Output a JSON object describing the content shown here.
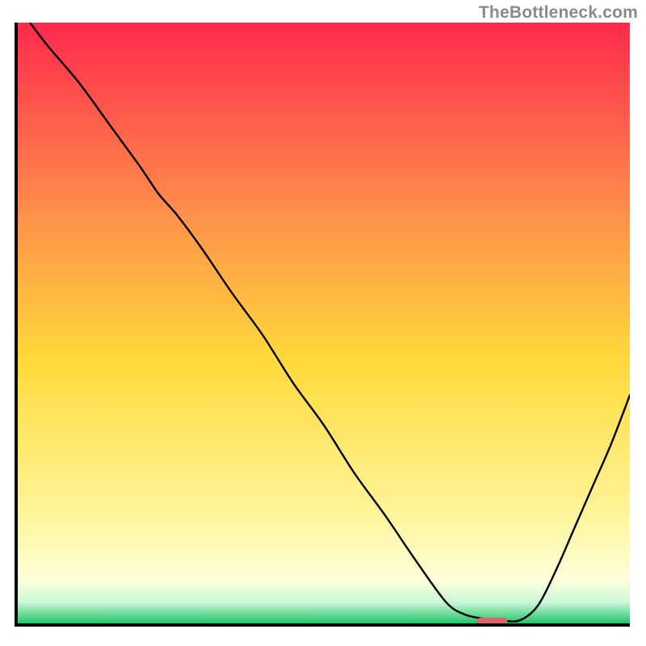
{
  "watermark": "TheBottleneck.com",
  "colors": {
    "axis": "#000000",
    "curve": "#000000",
    "marker": "#d9646a",
    "gradient_top": "#ff2a4d",
    "gradient_mid_upper": "#ff934a",
    "gradient_mid": "#ffd93a",
    "gradient_mid_lower": "#fff59a",
    "gradient_low": "#fcffdc",
    "gradient_bottom": "#22c46a"
  },
  "chart_data": {
    "type": "line",
    "title": "",
    "xlabel": "",
    "ylabel": "",
    "xlim": [
      0,
      100
    ],
    "ylim": [
      0,
      100
    ],
    "x": [
      2,
      5,
      10,
      15,
      20,
      23,
      26,
      30,
      35,
      40,
      45,
      50,
      55,
      60,
      65,
      70,
      73,
      76,
      79,
      82,
      85,
      88,
      91,
      94,
      97,
      100
    ],
    "values": [
      100,
      96,
      90,
      83,
      76,
      71.5,
      68,
      62.5,
      55,
      48,
      40,
      33,
      25,
      18,
      10.5,
      3.5,
      1.5,
      0.8,
      0.5,
      0.5,
      3,
      9,
      16,
      23,
      30,
      38
    ],
    "marker": {
      "x_start": 75,
      "x_end": 80,
      "y": 0.3
    },
    "annotations": []
  }
}
